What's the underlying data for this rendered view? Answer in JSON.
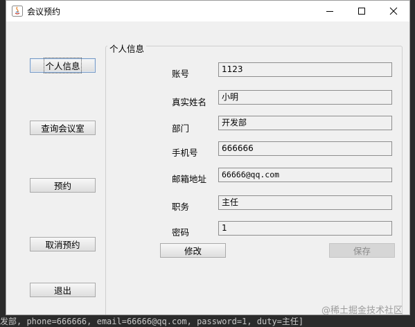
{
  "background": {
    "console_text": "发部, phone=666666, email=66666@qq.com, password=1, duty=主任]"
  },
  "window": {
    "title": "会议预约",
    "controls": {
      "minimize": "—",
      "maximize": "☐",
      "close": "✕"
    }
  },
  "sidebar": {
    "items": [
      {
        "label": "个人信息"
      },
      {
        "label": "查询会议室"
      },
      {
        "label": "预约"
      },
      {
        "label": "取消预约"
      },
      {
        "label": "退出"
      }
    ]
  },
  "panel": {
    "title": "个人信息",
    "fields": [
      {
        "label": "账号",
        "value": "1123"
      },
      {
        "label": "真实姓名",
        "value": "小明"
      },
      {
        "label": "部门",
        "value": "开发部"
      },
      {
        "label": "手机号",
        "value": "666666"
      },
      {
        "label": "邮箱地址",
        "value": "66666@qq.com"
      },
      {
        "label": "职务",
        "value": "主任"
      },
      {
        "label": "密码",
        "value": "1"
      }
    ],
    "edit_label": "修改",
    "save_label": "保存"
  },
  "watermark": "@稀土掘金技术社区",
  "colors": {
    "window_bg": "#f0f0f0",
    "outer_bg": "#2b2b2b"
  }
}
